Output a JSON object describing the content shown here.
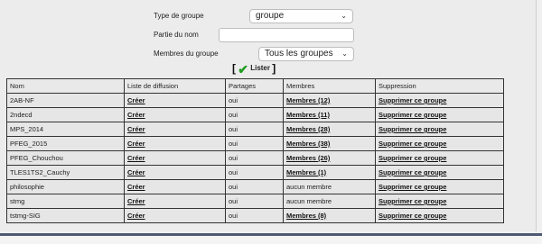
{
  "form": {
    "type_label": "Type de groupe",
    "type_value": "groupe",
    "name_label": "Partie du nom",
    "name_value": "",
    "members_label": "Membres du groupe",
    "members_value": "Tous les groupes",
    "list_bracket_open": "[",
    "list_label": "Lister",
    "list_bracket_close": "]"
  },
  "table": {
    "headers": [
      "Nom",
      "Liste de diffusion",
      "Partages",
      "Membres",
      "Suppression"
    ],
    "rows": [
      {
        "name": "2AB-NF",
        "diffusion": "Créer",
        "partages": "oui",
        "membres": "Membres (12)",
        "membres_link": true,
        "suppr": "Supprimer ce groupe"
      },
      {
        "name": "2ndecd",
        "diffusion": "Créer",
        "partages": "oui",
        "membres": "Membres (11)",
        "membres_link": true,
        "suppr": "Supprimer ce groupe"
      },
      {
        "name": "MPS_2014",
        "diffusion": "Créer",
        "partages": "oui",
        "membres": "Membres (28)",
        "membres_link": true,
        "suppr": "Supprimer ce groupe"
      },
      {
        "name": "PFEG_2015",
        "diffusion": "Créer",
        "partages": "oui",
        "membres": "Membres (38)",
        "membres_link": true,
        "suppr": "Supprimer ce groupe"
      },
      {
        "name": "PFEG_Chouchou",
        "diffusion": "Créer",
        "partages": "oui",
        "membres": "Membres (26)",
        "membres_link": true,
        "suppr": "Supprimer ce groupe"
      },
      {
        "name": "TLES1TS2_Cauchy",
        "diffusion": "Créer",
        "partages": "oui",
        "membres": "Membres (1)",
        "membres_link": true,
        "suppr": "Supprimer ce groupe"
      },
      {
        "name": "philosophie",
        "diffusion": "Créer",
        "partages": "oui",
        "membres": "aucun membre",
        "membres_link": false,
        "suppr": "Supprimer ce groupe"
      },
      {
        "name": "stmg",
        "diffusion": "Créer",
        "partages": "oui",
        "membres": "aucun membre",
        "membres_link": false,
        "suppr": "Supprimer ce groupe"
      },
      {
        "name": "tstmg-SIG",
        "diffusion": "Créer",
        "partages": "oui",
        "membres": "Membres (8)",
        "membres_link": true,
        "suppr": "Supprimer ce groupe"
      }
    ]
  },
  "icons": {
    "dropdown": "chevron-down-icon",
    "list": "checkmark-icon"
  },
  "colors": {
    "check": "#1f9d1f",
    "footer_line": "#4d5a74"
  }
}
